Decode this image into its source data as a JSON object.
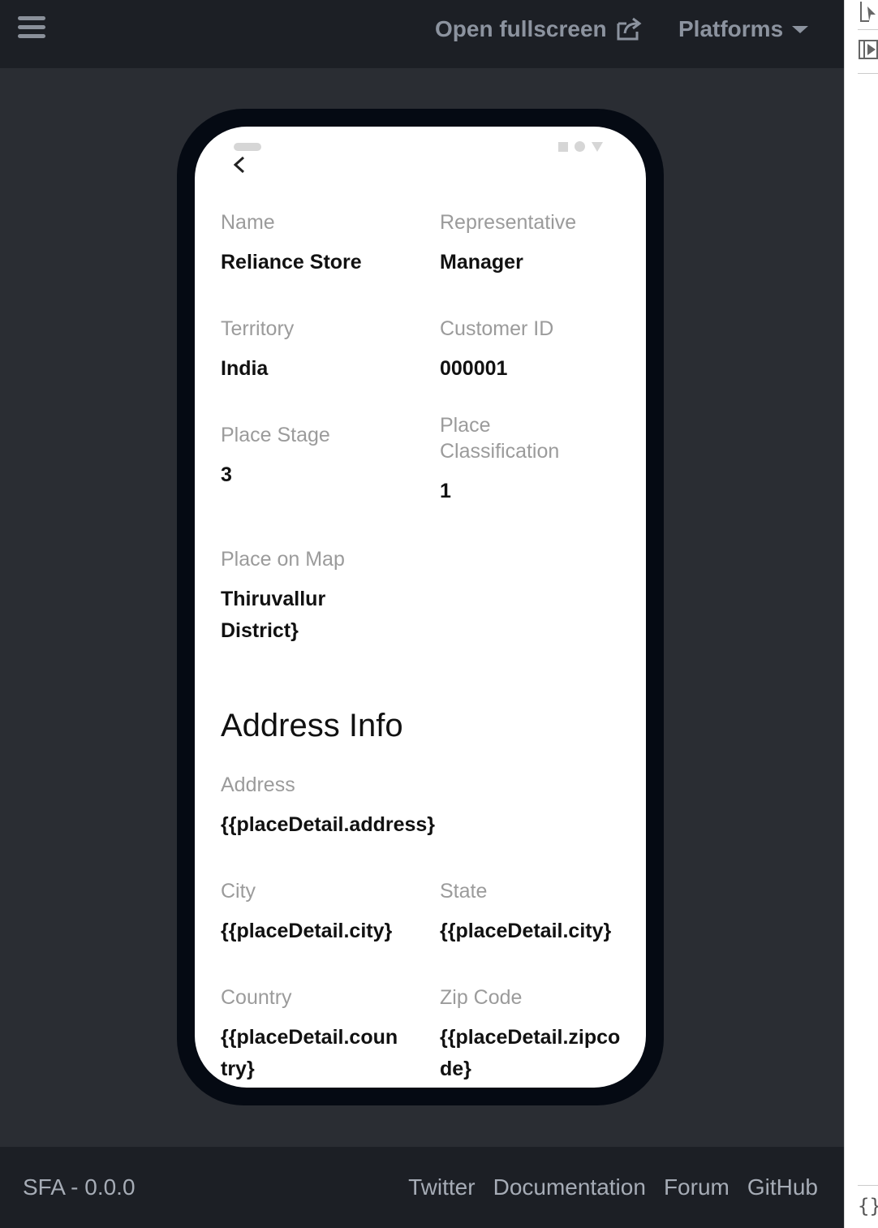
{
  "topbar": {
    "open_fullscreen": "Open fullscreen",
    "platforms": "Platforms"
  },
  "detail": {
    "name_label": "Name",
    "name_value": "Reliance Store",
    "representative_label": "Representative",
    "representative_value": "Manager",
    "territory_label": "Territory",
    "territory_value": "India",
    "customer_id_label": "Customer ID",
    "customer_id_value": "000001",
    "place_stage_label": "Place Stage",
    "place_stage_value": "3",
    "place_classification_label": "Place Classification",
    "place_classification_value": "1",
    "place_on_map_label": "Place on Map",
    "place_on_map_value": "Thiruvallur District}"
  },
  "address": {
    "section_title": "Address Info",
    "address_label": "Address",
    "address_value": "{{placeDetail.address}",
    "city_label": "City",
    "city_value": "{{placeDetail.city}",
    "state_label": "State",
    "state_value": "{{placeDetail.city}",
    "country_label": "Country",
    "country_value": "{{placeDetail.country}",
    "zip_label": "Zip Code",
    "zip_value": "{{placeDetail.zipcode}"
  },
  "footer": {
    "version": "SFA - 0.0.0",
    "links": [
      "Twitter",
      "Documentation",
      "Forum",
      "GitHub"
    ]
  },
  "side_panel": {
    "code_glyph": "{}"
  }
}
